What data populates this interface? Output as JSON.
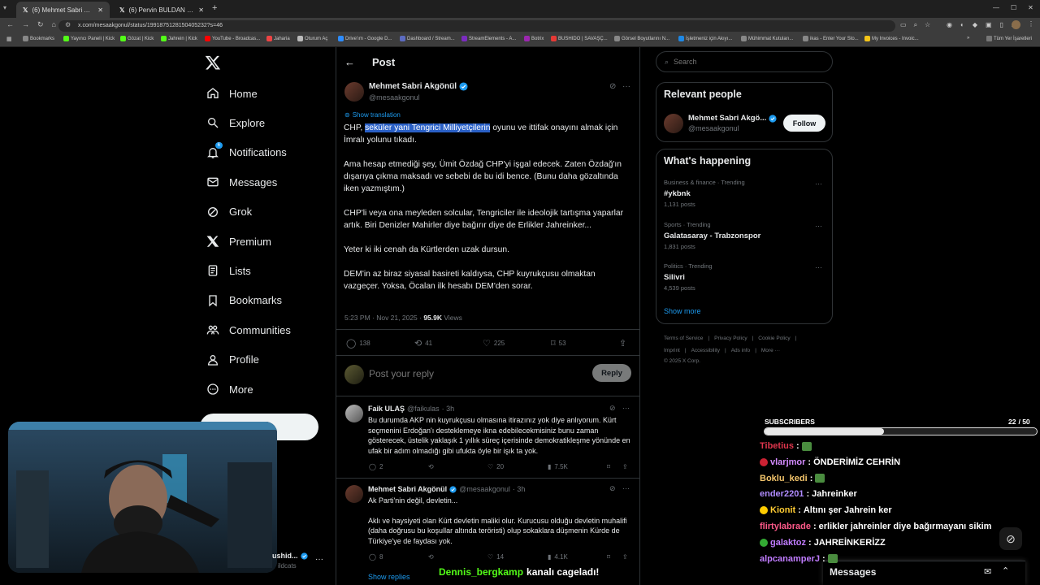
{
  "browser": {
    "tabs": [
      {
        "label": "(6) Mehmet Sabri Akgönül on X"
      },
      {
        "label": "(6) Pervin BULDAN on X: \"Ana"
      }
    ],
    "new_tab": "+",
    "url": "x.com/mesaakgonul/status/1991875128150405232?s=46",
    "bookmarks": [
      "Bookmarks",
      "Yayıncı Paneli | Kick",
      "Gözat | Kick",
      "Jahrein | Kick",
      "YouTube - Broadcas...",
      "Jaharia",
      "Oturum Aç",
      "Drive'ım - Google D...",
      "Dashboard / Stream...",
      "StreamElements - A...",
      "Botrix",
      "BUSHIDO | SAVAŞÇ...",
      "Görsel Boyutlarını N...",
      "İşletmeniz için Akıyı...",
      "Mühimmat Kutuları...",
      "ikas - Enter Your Sto...",
      "My Invoices - Invoic..."
    ],
    "all_bookmarks": "Tüm Yer İşaretleri"
  },
  "nav": {
    "items": [
      {
        "label": "Home"
      },
      {
        "label": "Explore"
      },
      {
        "label": "Notifications",
        "badge": "6"
      },
      {
        "label": "Messages"
      },
      {
        "label": "Grok"
      },
      {
        "label": "Premium"
      },
      {
        "label": "Lists"
      },
      {
        "label": "Bookmarks"
      },
      {
        "label": "Communities"
      },
      {
        "label": "Profile"
      },
      {
        "label": "More"
      }
    ],
    "account": {
      "name": "ushid...",
      "handle": "ildcats"
    }
  },
  "header": {
    "title": "Post"
  },
  "post": {
    "author": "Mehmet Sabri Akgönül",
    "handle": "@mesaakgonul",
    "show_translation": "Show translation",
    "p1_pre": "CHP, ",
    "p1_sel": "seküler yani Tengrici Milliyetçilerin",
    "p1_post": " oyunu ve ittifak onayını almak için İmralı yolunu tıkadı.",
    "p2": "Ama hesap etmediği şey, Ümit Özdağ CHP'yi işgal edecek. Zaten Özdağ'ın dışarıya çıkma maksadı ve sebebi de bu idi bence. (Bunu daha gözaltında iken yazmıştım.)",
    "p3": "CHP'li veya ona meyleden solcular, Tengriciler ile ideolojik tartışma yaparlar artık. Biri Denizler Mahirler diye bağırır diye de Erlikler Jahreinker...",
    "p4": "Yeter ki iki cenah da Kürtlerden uzak dursun.",
    "p5": "DEM'in az biraz siyasal basireti kaldıysa, CHP kuyrukçusu olmaktan vazgeçer. Yoksa, Öcalan ilk hesabı DEM'den sorar.",
    "time": "5:23 PM · Nov 21, 2025 · ",
    "views_count": "95.9K",
    "views_label": " Views",
    "replies": "138",
    "reposts": "41",
    "likes": "225",
    "bookmarks": "53"
  },
  "composer": {
    "placeholder": "Post your reply",
    "button": "Reply"
  },
  "replies": [
    {
      "author": "Faik ULAŞ",
      "handle": "@faikulas",
      "time": "· 3h",
      "text": "Bu durumda AKP nin kuyrukçusu olmasına itirazınız yok diye anlıyorum. Kürt seçmenini Erdoğan'ı desteklemeye ikna edebilecekmisiniz bunu zaman gösterecek, üstelik yaklaşık 1 yıllık süreç içerisinde demokratikleşme yönünde en ufak bir adım olmadığı gibi ufukta öyle bir işık ta yok.",
      "replies": "2",
      "likes": "20",
      "views": "7.5K"
    },
    {
      "author": "Mehmet Sabri Akgönül",
      "handle": "@mesaakgonul",
      "time": "· 3h",
      "text1": "Ak Parti'nin değil, devletin...",
      "text2": "Aklı ve haysiyeti olan Kürt devletin maliki olur. Kurucusu olduğu devletin muhalifi (daha doğrusu bu koşullar altında teröristi) olup sokaklara düşmenin Kürde de Türkiye'ye de faydası yok.",
      "replies": "8",
      "likes": "14",
      "views": "4.1K",
      "show_replies": "Show replies"
    }
  ],
  "sidebar": {
    "search_placeholder": "Search",
    "relevant_title": "Relevant people",
    "rp_name": "Mehmet Sabri Akgö...",
    "rp_handle": "@mesaakgonul",
    "follow": "Follow",
    "happening_title": "What's happening",
    "trends": [
      {
        "context": "Business & finance · Trending",
        "name": "#ykbnk",
        "posts": "1,131 posts"
      },
      {
        "context": "Sports · Trending",
        "name": "Galatasaray - Trabzonspor",
        "posts": "1,831 posts"
      },
      {
        "context": "Politics · Trending",
        "name": "Silivri",
        "posts": "4,539 posts"
      }
    ],
    "show_more": "Show more",
    "footer1": [
      "Terms of Service",
      "|",
      "Privacy Policy",
      "|",
      "Cookie Policy",
      "|"
    ],
    "footer2": [
      "Imprint",
      "|",
      "Accessibility",
      "|",
      "Ads info",
      "|",
      "More ···"
    ],
    "copyright": "© 2025 X Corp."
  },
  "stream": {
    "subs_label": "SUBSCRIBERS",
    "subs_count": "22",
    "subs_goal": "/ 50",
    "subs_fraction": 0.44,
    "chat": [
      {
        "user": "Tibetius",
        "msg": "",
        "color": "#e0364d"
      },
      {
        "user": "vlarjmor",
        "msg": "ÖNDERİMİZ CEHRİN",
        "color": "#d48cff"
      },
      {
        "user": "Boklu_kedi",
        "msg": "",
        "color": "#f2c46b"
      },
      {
        "user": "ender2201",
        "msg": "Jahreinker",
        "color": "#b08bff"
      },
      {
        "user": "Kionit",
        "msg": "Altını şer Jahrein ker",
        "color": "#ffcc33"
      },
      {
        "user": "flirtylabrade",
        "msg": "erlikler jahreinler diye bağırmayanı sikim",
        "color": "#ff5a8a"
      },
      {
        "user": "galaktoz",
        "msg": "JAHREİNKERİZZ",
        "color": "#c07cff"
      },
      {
        "user": "alpcanamperJ",
        "msg": "",
        "color": "#c07cff"
      }
    ],
    "overlay_user": "Dennis_bergkamp",
    "overlay_msg": "kanalı cageladı!",
    "messages_label": "Messages"
  }
}
